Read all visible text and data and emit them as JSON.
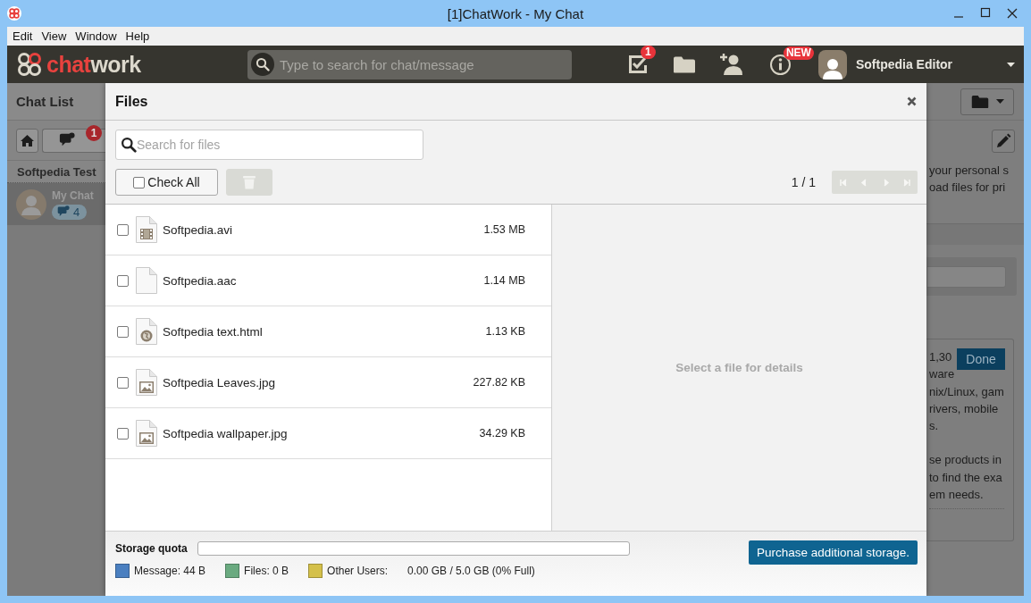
{
  "window": {
    "title": "[1]ChatWork - My Chat"
  },
  "menu": [
    "Edit",
    "View",
    "Window",
    "Help"
  ],
  "header": {
    "logo": [
      "chat",
      "work"
    ],
    "search": {
      "placeholder": "Type to search for chat/message"
    },
    "tasks_badge": "1",
    "info_badge": "NEW",
    "user": "Softpedia Editor"
  },
  "chat_list": {
    "title": "Chat List",
    "messages_badge": "1",
    "group": "Softpedia Test",
    "chats": [
      {
        "name": "My Chat",
        "count": "4",
        "selected": true
      }
    ]
  },
  "side_panel": {
    "intro": [
      "your personal s",
      "oad files for pri"
    ],
    "task": {
      "done_button": "Done",
      "paragraphs": [
        [
          "1,30",
          "ware",
          "nix/Linux, gam",
          "rivers, mobile",
          "s."
        ],
        [
          "se products in",
          "to find the exa",
          "em needs."
        ]
      ]
    }
  },
  "files_dialog": {
    "title": "Files",
    "search": {
      "placeholder": "Search for files"
    },
    "check_all": {
      "label": "Check All",
      "checked": false
    },
    "delete_disabled": true,
    "pager": "1 / 1",
    "pager_nav_disabled": true,
    "files": [
      {
        "name": "Softpedia.avi",
        "size": "1.53 MB",
        "kind": "video",
        "checked": false
      },
      {
        "name": "Softpedia.aac",
        "size": "1.14 MB",
        "kind": "file",
        "checked": false
      },
      {
        "name": "Softpedia text.html",
        "size": "1.13 KB",
        "kind": "web",
        "checked": false
      },
      {
        "name": "Softpedia Leaves.jpg",
        "size": "227.82 KB",
        "kind": "image",
        "checked": false
      },
      {
        "name": "Softpedia wallpaper.jpg",
        "size": "34.29 KB",
        "kind": "image",
        "checked": false
      }
    ],
    "details_placeholder": "Select a file for details",
    "storage": {
      "label": "Storage quota",
      "level": 0,
      "legend": [
        {
          "label": "Message: 44 B",
          "color": "#4a7fc0"
        },
        {
          "label": "Files: 0 B",
          "color": "#6aaa80"
        },
        {
          "label": "Other Users:",
          "color": "#d4c04a"
        }
      ],
      "usage": "0.00 GB / 5.0 GB (0% Full)",
      "purchase_button": "Purchase additional storage."
    }
  }
}
